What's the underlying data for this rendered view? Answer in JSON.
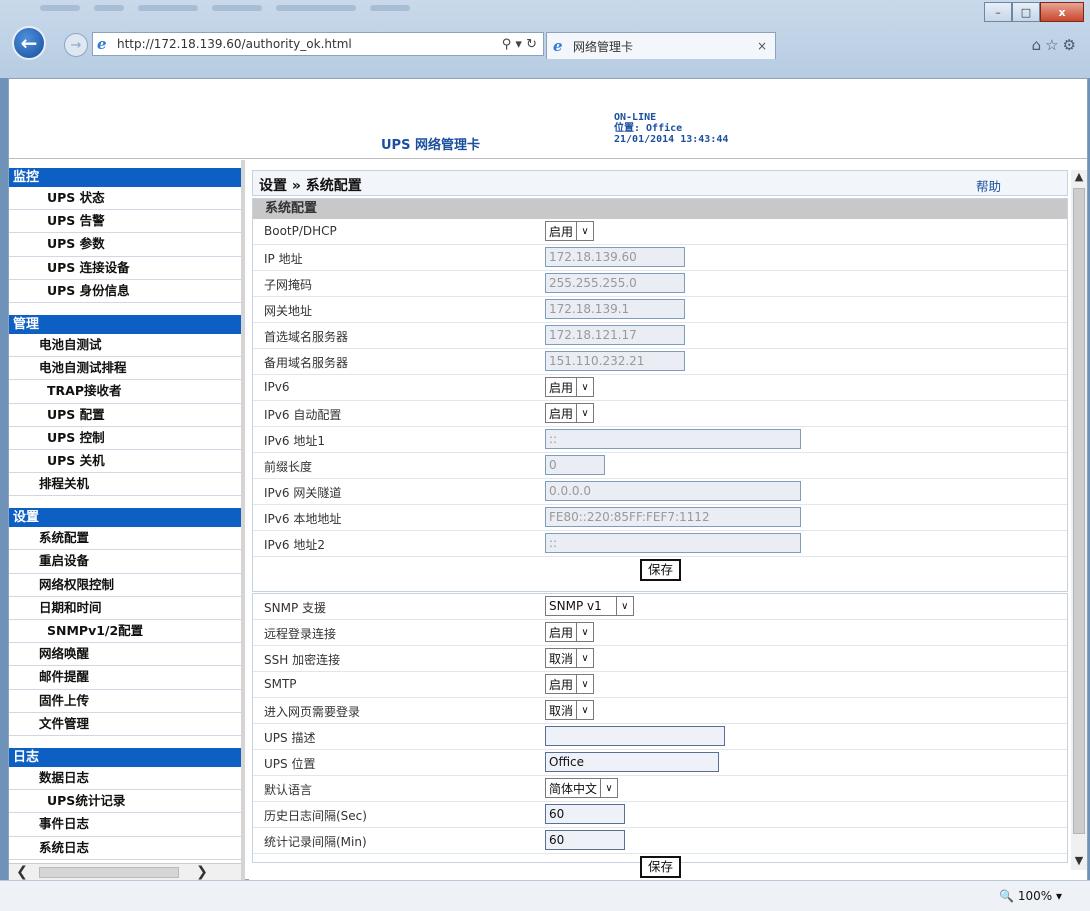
{
  "browser": {
    "url": "http://172.18.139.60/authority_ok.html",
    "tab_title": "网络管理卡",
    "tab_close": "×",
    "win_min": "–",
    "win_max": "□",
    "win_close": "x",
    "zoom": "100%"
  },
  "header": {
    "brand": "UPS 网络管理卡",
    "status_line1": "ON-LINE",
    "status_line2": "位置: Office",
    "status_line3": "21/01/2014 13:43:44"
  },
  "sidebar": {
    "sections": [
      {
        "title": "监控",
        "items": [
          "UPS 状态",
          "UPS 告警",
          "UPS 参数",
          "UPS 连接设备",
          "UPS 身份信息"
        ]
      },
      {
        "title": "管理",
        "items": [
          "电池自测试",
          "电池自测试排程",
          "TRAP接收者",
          "UPS 配置",
          "UPS 控制",
          "UPS 关机",
          "排程关机"
        ]
      },
      {
        "title": "设置",
        "items": [
          "系统配置",
          "重启设备",
          "网络权限控制",
          "日期和时间",
          "SNMPv1/2配置",
          "网络唤醒",
          "邮件提醒",
          "固件上传",
          "文件管理"
        ]
      },
      {
        "title": "日志",
        "items": [
          "数据日志",
          "UPS统计记录",
          "事件日志",
          "系统日志"
        ]
      }
    ]
  },
  "main": {
    "breadcrumb": "设置 » 系统配置",
    "help": "帮助",
    "panel1_title": "系统配置",
    "save_label": "保存",
    "panel1_rows": [
      {
        "label": "BootP/DHCP",
        "type": "select",
        "value": "启用"
      },
      {
        "label": "IP 地址",
        "type": "text-disabled",
        "value": "172.18.139.60"
      },
      {
        "label": "子网掩码",
        "type": "text-disabled",
        "value": "255.255.255.0"
      },
      {
        "label": "网关地址",
        "type": "text-disabled",
        "value": "172.18.139.1"
      },
      {
        "label": "首选域名服务器",
        "type": "text-disabled",
        "value": "172.18.121.17"
      },
      {
        "label": "备用域名服务器",
        "type": "text-disabled",
        "value": "151.110.232.21"
      },
      {
        "label": "IPv6",
        "type": "select",
        "value": "启用"
      },
      {
        "label": "IPv6 自动配置",
        "type": "select",
        "value": "启用"
      },
      {
        "label": "IPv6 地址1",
        "type": "text-disabled",
        "value": "::"
      },
      {
        "label": "前缀长度",
        "type": "text-disabled",
        "value": "0"
      },
      {
        "label": "IPv6 网关隧道",
        "type": "text-disabled",
        "value": "0.0.0.0"
      },
      {
        "label": "IPv6 本地地址",
        "type": "text-disabled",
        "value": "FE80::220:85FF:FEF7:1112"
      },
      {
        "label": "IPv6 地址2",
        "type": "text-disabled",
        "value": "::"
      }
    ],
    "panel2_rows": [
      {
        "label": "SNMP 支援",
        "type": "select",
        "value": "SNMP v1"
      },
      {
        "label": "远程登录连接",
        "type": "select",
        "value": "启用"
      },
      {
        "label": "SSH 加密连接",
        "type": "select",
        "value": "取消"
      },
      {
        "label": "SMTP",
        "type": "select",
        "value": "启用"
      },
      {
        "label": "进入网页需要登录",
        "type": "select",
        "value": "取消"
      },
      {
        "label": "UPS 描述",
        "type": "text",
        "value": ""
      },
      {
        "label": "UPS 位置",
        "type": "text",
        "value": "Office"
      },
      {
        "label": "默认语言",
        "type": "select",
        "value": "简体中文"
      },
      {
        "label": "历史日志间隔(Sec)",
        "type": "text",
        "value": "60"
      },
      {
        "label": "统计记录间隔(Min)",
        "type": "text",
        "value": "60"
      }
    ]
  }
}
